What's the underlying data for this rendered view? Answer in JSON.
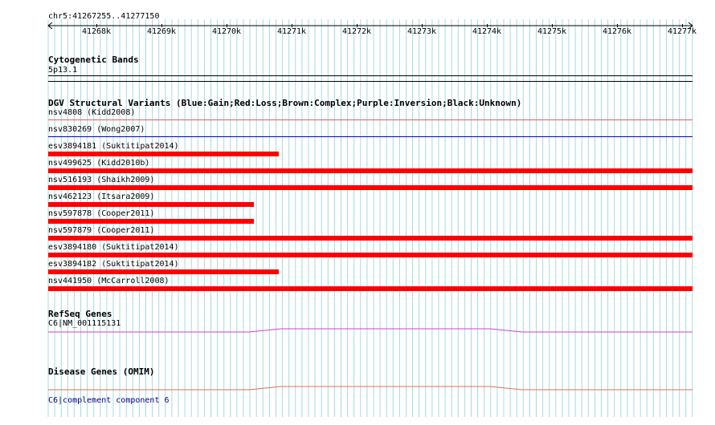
{
  "coordinates": "chr5:41267255..41277150",
  "ruler": {
    "ticks": [
      "41268k",
      "41269k",
      "41270k",
      "41271k",
      "41272k",
      "41273k",
      "41274k",
      "41275k",
      "41276k",
      "41277k"
    ]
  },
  "tracks": {
    "cytoband": {
      "title": "Cytogenetic Bands",
      "band": "5p13.1"
    },
    "dgv": {
      "title": "DGV Structural Variants (Blue:Gain;Red:Loss;Brown:Complex;Purple:Inversion;Black:Unknown)",
      "items": [
        {
          "label": "nsv4808 (Kidd2008)",
          "type": "loss",
          "extent": "full",
          "style": "line",
          "color": "#e06060"
        },
        {
          "label": "nsv830269 (Wong2007)",
          "type": "gain",
          "extent": "full",
          "style": "line",
          "color": "#0000cc"
        },
        {
          "label": "esv3894181 (Suktitipat2014)",
          "type": "loss",
          "extent": "partial-357",
          "style": "bar",
          "color": "#ff0000"
        },
        {
          "label": "nsv499625 (Kidd2010b)",
          "type": "loss",
          "extent": "full",
          "style": "bar",
          "color": "#ff0000"
        },
        {
          "label": "nsv516193 (Shaikh2009)",
          "type": "loss",
          "extent": "full",
          "style": "bar",
          "color": "#ff0000"
        },
        {
          "label": "nsv462123 (Itsara2009)",
          "type": "loss",
          "extent": "partial-318",
          "style": "bar",
          "color": "#ff0000"
        },
        {
          "label": "nsv597878 (Cooper2011)",
          "type": "loss",
          "extent": "partial-318",
          "style": "bar",
          "color": "#ff0000"
        },
        {
          "label": "nsv597879 (Cooper2011)",
          "type": "loss",
          "extent": "full",
          "style": "bar",
          "color": "#ff0000"
        },
        {
          "label": "esv3894180 (Suktitipat2014)",
          "type": "loss",
          "extent": "full",
          "style": "bar",
          "color": "#ff0000"
        },
        {
          "label": "esv3894182 (Suktitipat2014)",
          "type": "loss",
          "extent": "partial-357",
          "style": "bar",
          "color": "#ff0000"
        },
        {
          "label": "nsv441950 (McCarroll2008)",
          "type": "loss",
          "extent": "full",
          "style": "bar",
          "color": "#ff0000"
        }
      ]
    },
    "refseq": {
      "title": "RefSeq Genes",
      "gene": "C6|NM_001115131",
      "color": "#cc44cc"
    },
    "omim": {
      "title": "Disease Genes (OMIM)",
      "gene": "C6|complement component 6",
      "color": "#e07050"
    }
  },
  "colors": {
    "grid": "#a8d8e0",
    "loss": "#ff0000",
    "gain": "#0000cc",
    "link": "#00008b"
  }
}
